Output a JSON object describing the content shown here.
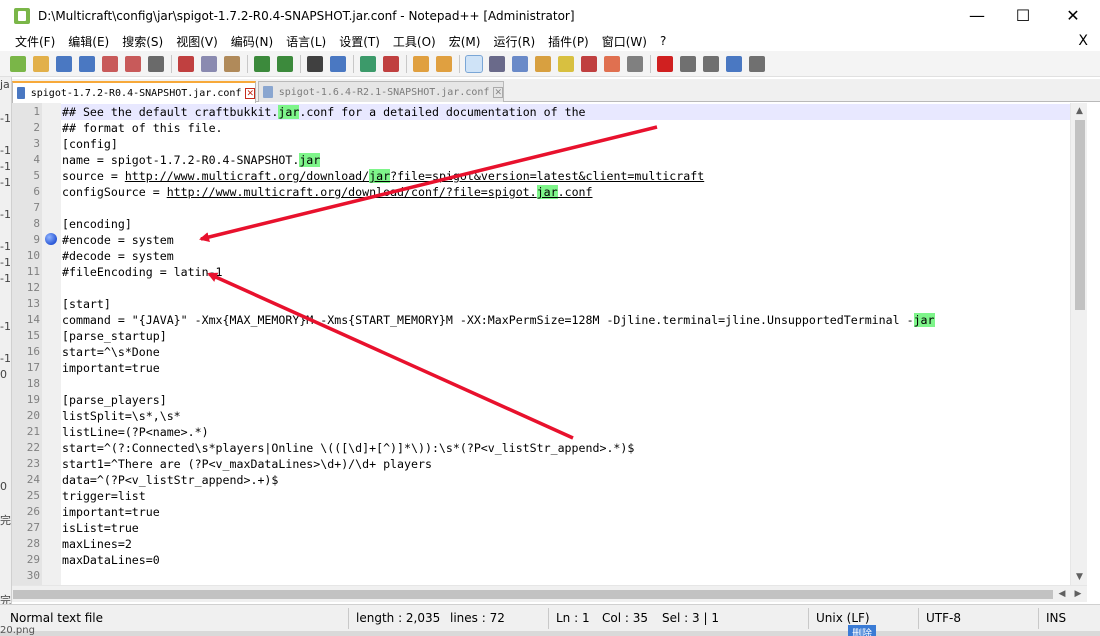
{
  "window": {
    "title": "D:\\Multicraft\\config\\jar\\spigot-1.7.2-R0.4-SNAPSHOT.jar.conf - Notepad++ [Administrator]",
    "minimize_glyph": "—",
    "maximize_glyph": "☐",
    "close_glyph": "✕"
  },
  "menu": {
    "items": [
      "文件(F)",
      "编辑(E)",
      "搜索(S)",
      "视图(V)",
      "编码(N)",
      "语言(L)",
      "设置(T)",
      "工具(O)",
      "宏(M)",
      "运行(R)",
      "插件(P)",
      "窗口(W)",
      "?"
    ],
    "close_glyph": "X"
  },
  "toolbar": {
    "icons": [
      "new-file-icon",
      "open-file-icon",
      "save-icon",
      "save-all-icon",
      "close-icon",
      "close-all-icon",
      "print-icon",
      "cut-icon",
      "copy-icon",
      "paste-icon",
      "undo-icon",
      "redo-icon",
      "find-icon",
      "replace-icon",
      "zoom-in-icon",
      "zoom-out-icon",
      "sync-vertical-icon",
      "sync-horizontal-icon",
      "word-wrap-icon",
      "show-all-chars-icon",
      "indent-guide-icon",
      "user-language-icon",
      "document-map-icon",
      "function-list-icon",
      "folder-workspace-icon",
      "monitoring-icon",
      "record-macro-icon",
      "stop-record-icon",
      "playback-macro-icon",
      "run-macro-multiple-icon",
      "save-macro-icon"
    ]
  },
  "tabs": [
    {
      "label": "spigot-1.7.2-R0.4-SNAPSHOT.jar.conf",
      "active": true
    },
    {
      "label": "spigot-1.6.4-R2.1-SNAPSHOT.jar.conf",
      "active": false
    }
  ],
  "editor": {
    "current_line": 1,
    "bookmarked_line": 9,
    "highlight_color": "#7ef58a",
    "lines": [
      {
        "n": "1",
        "segments": [
          {
            "t": "## See the default craftbukkit."
          },
          {
            "t": "jar",
            "hl": true
          },
          {
            "t": ".conf for a detailed documentation of the"
          }
        ]
      },
      {
        "n": "2",
        "segments": [
          {
            "t": "## format of this file."
          }
        ]
      },
      {
        "n": "3",
        "segments": [
          {
            "t": "[config]"
          }
        ]
      },
      {
        "n": "4",
        "segments": [
          {
            "t": "name = spigot-1.7.2-R0.4-SNAPSHOT."
          },
          {
            "t": "jar",
            "hl": true
          }
        ]
      },
      {
        "n": "5",
        "segments": [
          {
            "t": "source = "
          },
          {
            "t": "http://www.multicraft.org/download/",
            "url": true
          },
          {
            "t": "jar",
            "hl": true,
            "url": true
          },
          {
            "t": "?file=spigot&version=latest&client=multicraft",
            "url": true
          }
        ]
      },
      {
        "n": "6",
        "segments": [
          {
            "t": "configSource = "
          },
          {
            "t": "http://www.multicraft.org/download/conf/?file=spigot.",
            "url": true
          },
          {
            "t": "jar",
            "hl": true,
            "url": true
          },
          {
            "t": ".conf",
            "url": true
          }
        ]
      },
      {
        "n": "7",
        "segments": [
          {
            "t": ""
          }
        ]
      },
      {
        "n": "8",
        "segments": [
          {
            "t": "[encoding]"
          }
        ]
      },
      {
        "n": "9",
        "segments": [
          {
            "t": "#encode = system"
          }
        ]
      },
      {
        "n": "10",
        "segments": [
          {
            "t": "#decode = system"
          }
        ]
      },
      {
        "n": "11",
        "segments": [
          {
            "t": "#fileEncoding = latin-1"
          }
        ]
      },
      {
        "n": "12",
        "segments": [
          {
            "t": ""
          }
        ]
      },
      {
        "n": "13",
        "segments": [
          {
            "t": "[start]"
          }
        ]
      },
      {
        "n": "14",
        "segments": [
          {
            "t": "command = \"{JAVA}\" -Xmx{MAX_MEMORY}M -Xms{START_MEMORY}M -XX:MaxPermSize=128M -Djline.terminal=jline.UnsupportedTerminal -"
          },
          {
            "t": "jar",
            "hl": true
          }
        ]
      },
      {
        "n": "15",
        "segments": [
          {
            "t": "[parse_startup]"
          }
        ]
      },
      {
        "n": "16",
        "segments": [
          {
            "t": "start=^\\s*Done"
          }
        ]
      },
      {
        "n": "17",
        "segments": [
          {
            "t": "important=true"
          }
        ]
      },
      {
        "n": "18",
        "segments": [
          {
            "t": ""
          }
        ]
      },
      {
        "n": "19",
        "segments": [
          {
            "t": "[parse_players]"
          }
        ]
      },
      {
        "n": "20",
        "segments": [
          {
            "t": "listSplit=\\s*,\\s*"
          }
        ]
      },
      {
        "n": "21",
        "segments": [
          {
            "t": "listLine=(?P<name>.*)"
          }
        ]
      },
      {
        "n": "22",
        "segments": [
          {
            "t": "start=^(?:Connected\\s*players|Online \\(([\\d]+[^)]*\\)):\\s*(?P<v_listStr_append>.*)$"
          }
        ]
      },
      {
        "n": "23",
        "segments": [
          {
            "t": "start1=^There are (?P<v_maxDataLines>\\d+)/\\d+ players"
          }
        ]
      },
      {
        "n": "24",
        "segments": [
          {
            "t": "data=^(?P<v_listStr_append>.+)$"
          }
        ]
      },
      {
        "n": "25",
        "segments": [
          {
            "t": "trigger=list"
          }
        ]
      },
      {
        "n": "26",
        "segments": [
          {
            "t": "important=true"
          }
        ]
      },
      {
        "n": "27",
        "segments": [
          {
            "t": "isList=true"
          }
        ]
      },
      {
        "n": "28",
        "segments": [
          {
            "t": "maxLines=2"
          }
        ]
      },
      {
        "n": "29",
        "segments": [
          {
            "t": "maxDataLines=0"
          }
        ]
      },
      {
        "n": "30",
        "segments": [
          {
            "t": ""
          }
        ]
      }
    ]
  },
  "scrollbar": {
    "up_glyph": "▲",
    "down_glyph": "▼",
    "left_glyph": "◀",
    "right_glyph": "▶"
  },
  "status": {
    "file_type": "Normal text file",
    "length": "length : 2,035",
    "lines": "lines : 72",
    "ln": "Ln : 1",
    "col": "Col : 35",
    "sel": "Sel : 3 | 1",
    "eol": "Unix (LF)",
    "encoding": "UTF-8",
    "mode": "INS"
  },
  "background_window": {
    "fragments": [
      "ja",
      "-1",
      "-1",
      "-1",
      "-1",
      "-1",
      "-1",
      "-1",
      "-1",
      "-1",
      "-1",
      "0",
      "0",
      "完",
      "完"
    ],
    "bottom_left": "20.png",
    "bottom_right": "删除"
  },
  "annotations": {
    "arrow_color": "#e8112d"
  }
}
